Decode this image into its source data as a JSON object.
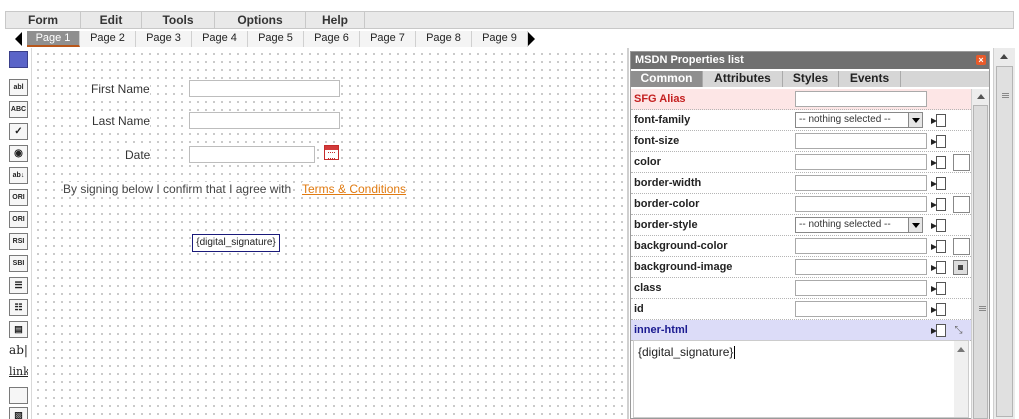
{
  "menu": {
    "items": [
      "Form",
      "Edit",
      "Tools",
      "Options",
      "Help"
    ]
  },
  "pages": {
    "tabs": [
      "Page 1",
      "Page 2",
      "Page 3",
      "Page 4",
      "Page 5",
      "Page 6",
      "Page 7",
      "Page 8",
      "Page 9"
    ],
    "active": "Page 1"
  },
  "toolbox": {
    "tools": [
      "abl",
      "ABC",
      "ORI",
      "ORI",
      "RSI",
      "SBI",
      "ab|",
      "link"
    ]
  },
  "form": {
    "first_name_label": "First Name",
    "last_name_label": "Last Name",
    "date_label": "Date",
    "consent_text": "By signing below I confirm that I agree with",
    "terms_link": "Terms & Conditions",
    "signature_placeholder": "{digital_signature}"
  },
  "panel": {
    "title": "MSDN Properties list",
    "close": "×",
    "tabs": [
      "Common",
      "Attributes",
      "Styles",
      "Events"
    ],
    "active_tab": "Common",
    "rows": [
      {
        "name": "SFG Alias",
        "control": "input"
      },
      {
        "name": "font-family",
        "control": "select",
        "value": "-- nothing selected --"
      },
      {
        "name": "font-size",
        "control": "input"
      },
      {
        "name": "color",
        "control": "input-swatch"
      },
      {
        "name": "border-width",
        "control": "input"
      },
      {
        "name": "border-color",
        "control": "input-swatch"
      },
      {
        "name": "border-style",
        "control": "select",
        "value": "-- nothing selected --"
      },
      {
        "name": "background-color",
        "control": "input-swatch"
      },
      {
        "name": "background-image",
        "control": "input-image"
      },
      {
        "name": "class",
        "control": "input"
      },
      {
        "name": "id",
        "control": "input"
      },
      {
        "name": "inner-html",
        "control": "expand"
      }
    ],
    "inner_html_value": "{digital_signature}"
  },
  "colors": {
    "alias_row": "#fde6e6",
    "inner_row": "#dcdcf8",
    "accent_link": "#e07a10",
    "active_tab": "#8f8f8f"
  }
}
